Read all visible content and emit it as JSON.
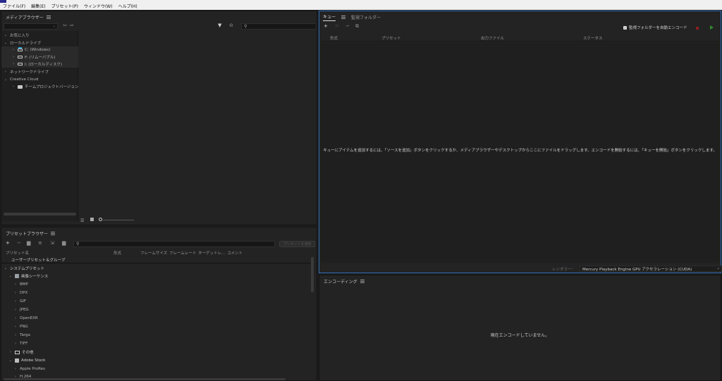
{
  "menubar": {
    "items": [
      "ファイル(F)",
      "編集(E)",
      "プリセット(P)",
      "ウィンドウ(W)",
      "ヘルプ(H)"
    ]
  },
  "media_browser": {
    "title": "メディアブラウザー",
    "tree": [
      {
        "label": "お気に入り",
        "level": 0
      },
      {
        "label": "ローカルドライブ",
        "level": 0
      },
      {
        "label": "C: (Windows)",
        "level": 1,
        "icon": "windows-drive-icon"
      },
      {
        "label": "F: (リムーバブル)",
        "level": 1,
        "icon": "removable-drive-icon"
      },
      {
        "label": "I: (ローカルディスク)",
        "level": 1,
        "icon": "local-disk-icon"
      },
      {
        "label": "ネットワークドライブ",
        "level": 0
      },
      {
        "label": "Creative Cloud",
        "level": 0
      },
      {
        "label": "チームプロジェクトバージョン",
        "level": 1,
        "icon": "team-project-icon"
      }
    ]
  },
  "preset_browser": {
    "title": "プリセットブラウザー",
    "apply_button": "プリセットを適用",
    "columns": [
      "プリセット名",
      "形式",
      "フレームサイズ",
      "フレームレート",
      "ターゲットレ...",
      "コメント"
    ],
    "rows": [
      {
        "label": "ユーザープリセット＆グループ",
        "level": 0,
        "chev": ""
      },
      {
        "label": "システムプリセット",
        "level": 0,
        "chev": "v"
      },
      {
        "label": "画像シーケンス",
        "level": 1,
        "chev": "v",
        "icon": "image-sequence-icon"
      },
      {
        "label": "BMP",
        "level": 2,
        "chev": ">"
      },
      {
        "label": "DPX",
        "level": 2,
        "chev": ">"
      },
      {
        "label": "GIF",
        "level": 2,
        "chev": ">"
      },
      {
        "label": "JPEG",
        "level": 2,
        "chev": ">"
      },
      {
        "label": "OpenEXR",
        "level": 2,
        "chev": ">"
      },
      {
        "label": "PNG",
        "level": 2,
        "chev": ">"
      },
      {
        "label": "Targa",
        "level": 2,
        "chev": ">"
      },
      {
        "label": "TIFF",
        "level": 2,
        "chev": ">"
      },
      {
        "label": "その他",
        "level": 1,
        "chev": ">",
        "icon": "monitor-icon"
      },
      {
        "label": "Adobe Stock",
        "level": 1,
        "chev": "v",
        "icon": "stock-icon"
      },
      {
        "label": "Apple ProRes",
        "level": 2,
        "chev": ">"
      },
      {
        "label": "H.264",
        "level": 2,
        "chev": ">"
      }
    ]
  },
  "queue": {
    "tab_queue": "キュー",
    "tab_watch": "監視フォルダー",
    "auto_encode_label": "監視フォルダーを自動エンコード",
    "columns": [
      "形式",
      "プリセット",
      "出力ファイル",
      "ステータス"
    ],
    "empty_message": "キューにアイテムを追加するには、「ソースを追加」ボタンをクリックするか、メディアブラウザーやデスクトップからここにファイルをドラッグします。エンコードを開始するには、「キューを開始」ボタンをクリックします。",
    "renderer_label": "レンダラー：",
    "renderer_value": "Mercury Playback Engine GPU アクセラレーション (CUDA)"
  },
  "encoding": {
    "title": "エンコーディング",
    "status": "現在エンコードしていません。"
  }
}
